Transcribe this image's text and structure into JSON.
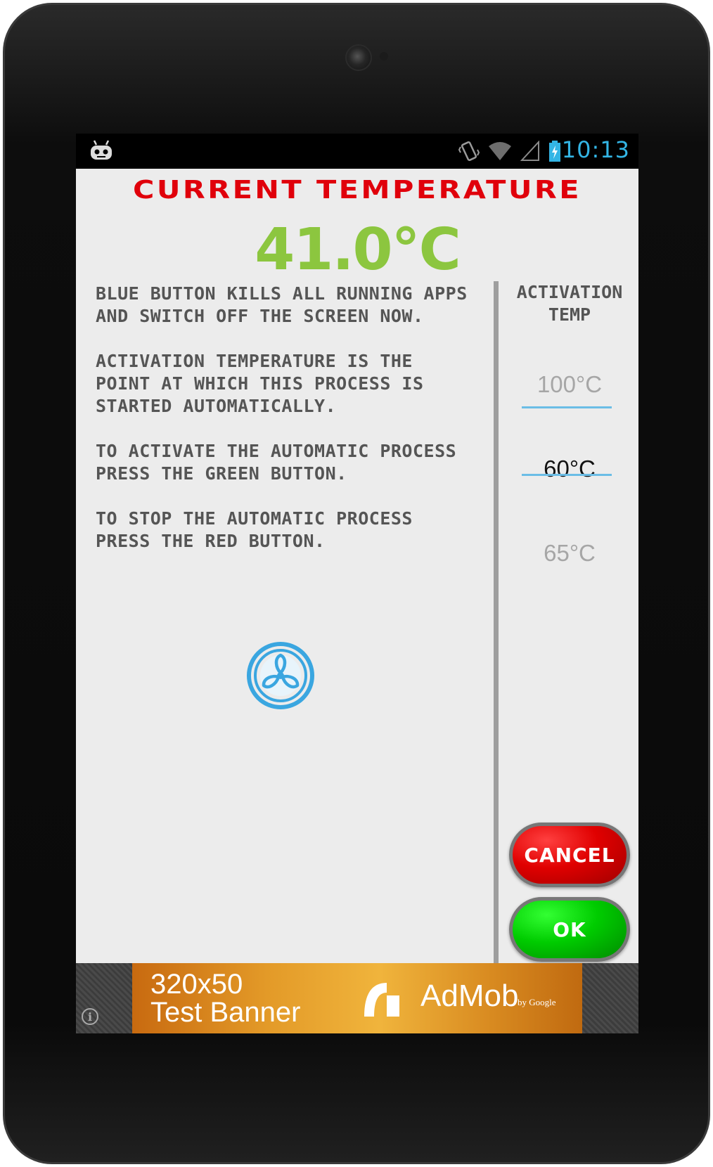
{
  "status_bar": {
    "time": "10:13"
  },
  "header": {
    "title": "Current temperature",
    "temperature": "41.0°C"
  },
  "description": [
    "Blue button kills all running apps and switch off the screen now.",
    "Activation temperature is the point at which this process is started automatically.",
    "To activate the automatic process press the green button.",
    "To stop the automatic process press the red button."
  ],
  "activation": {
    "title": "Activation temp",
    "picker": {
      "previous": "100°C",
      "selected": "60°C",
      "next": "65°C"
    }
  },
  "buttons": {
    "cancel": "CANCEL",
    "ok": "OK"
  },
  "ad": {
    "line1": "320x50",
    "line2": "Test Banner",
    "brand": "AdMob",
    "by": "by Google",
    "info": "i"
  },
  "colors": {
    "title_red": "#e0000b",
    "temp_green": "#8cc63f",
    "accent_blue": "#33b5e5",
    "cancel_red": "#e00000",
    "ok_green": "#00cc00"
  }
}
